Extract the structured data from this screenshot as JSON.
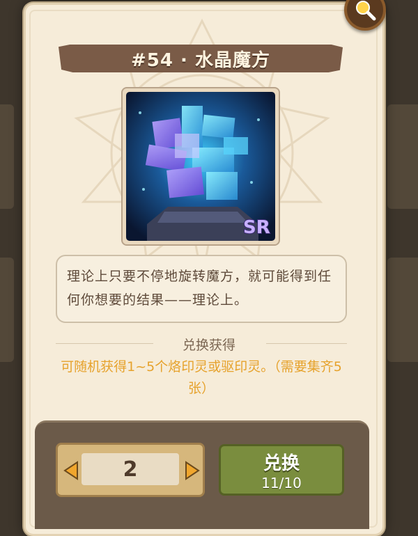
{
  "card": {
    "title": "#54 · 水晶魔方",
    "rarity": "SR",
    "description": "理论上只要不停地旋转魔方，就可能得到任何你想要的结果——理论上。"
  },
  "exchange": {
    "section_label": "兑换获得",
    "reward_text": "可随机获得1~5个烙印灵或驱印灵。（需要集齐5张）",
    "quantity": "2",
    "button_label": "兑换",
    "count": "11/10"
  },
  "colors": {
    "panel_bg": "#f6ecd9",
    "title_bar": "#7a5b47",
    "reward_text": "#e6a22c",
    "exchange_button": "#7a8d3e",
    "rarity_badge": "#b69bf0"
  },
  "icons": [
    "search-icon",
    "chevron-left-icon",
    "chevron-right-icon",
    "crystal-cube-image"
  ]
}
